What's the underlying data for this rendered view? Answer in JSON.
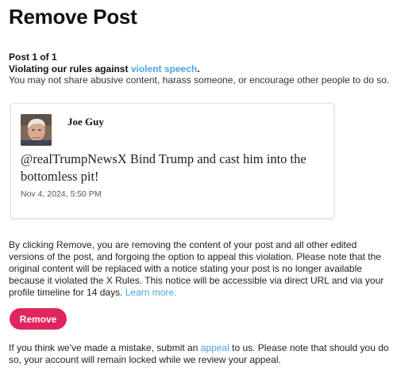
{
  "page": {
    "title": "Remove Post"
  },
  "violation": {
    "post_count": "Post 1 of 1",
    "rule_prefix": "Violating our rules against ",
    "rule_link": "violent speech",
    "rule_suffix": ".",
    "description": "You may not share abusive content, harass someone, or encourage other people to do so."
  },
  "tweet": {
    "author": "Joe Guy",
    "text": "@realTrumpNewsX Bind Trump and cast him into the bottomless pit!",
    "timestamp": "Nov 4, 2024, 5:50 PM",
    "avatar_icon": "user-avatar-photo"
  },
  "explanation": {
    "text": "By clicking Remove, you are removing the content of your post and all other edited versions of the post, and forgoing the option to appeal this violation. Please note that the original content will be replaced with a notice stating your post is no longer available because it violated the X Rules. This notice will be accessible via direct URL and via your profile timeline for 14 days. ",
    "learn_more": "Learn more."
  },
  "actions": {
    "remove_label": "Remove"
  },
  "footer": {
    "prefix": "If you think we've made a mistake, submit an ",
    "appeal_link": "appeal",
    "suffix": " to us. Please note that should you do so, your account will remain locked while we review your appeal."
  },
  "colors": {
    "link": "#4aa3df",
    "remove_button": "#e0245e",
    "text": "#111111"
  }
}
